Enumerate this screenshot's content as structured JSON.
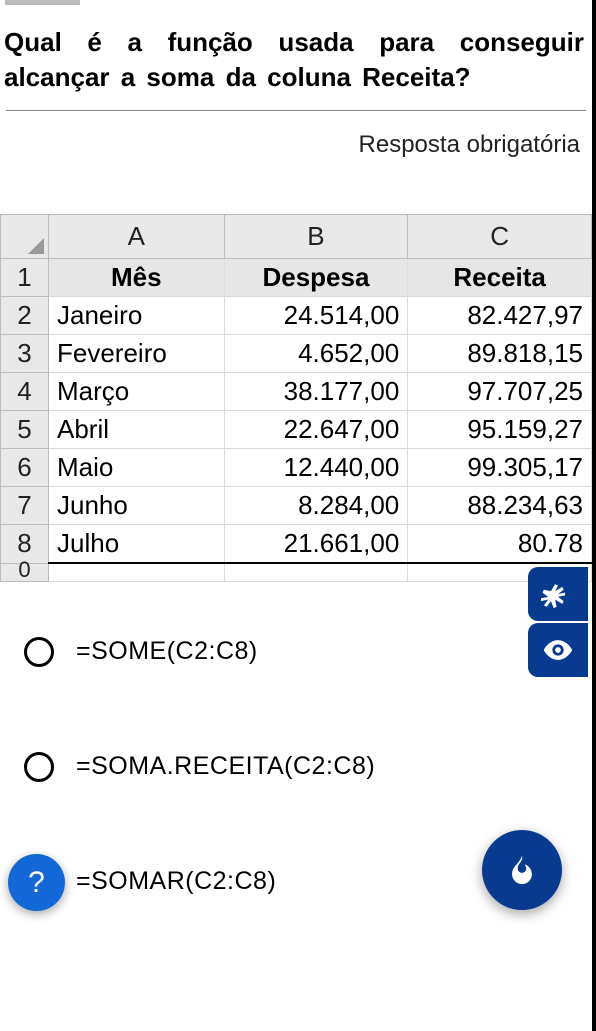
{
  "question": {
    "line1": "Qual é a função usada para conseguir",
    "line2": "alcançar a soma da coluna Receita?"
  },
  "required_label": "Resposta obrigatória",
  "chart_data": {
    "type": "table",
    "columns": [
      "A",
      "B",
      "C"
    ],
    "headers": {
      "A": "Mês",
      "B": "Despesa",
      "C": "Receita"
    },
    "rows": [
      {
        "n": "2",
        "mes": "Janeiro",
        "despesa": "24.514,00",
        "receita": "82.427,97"
      },
      {
        "n": "3",
        "mes": "Fevereiro",
        "despesa": "4.652,00",
        "receita": "89.818,15"
      },
      {
        "n": "4",
        "mes": "Março",
        "despesa": "38.177,00",
        "receita": "97.707,25"
      },
      {
        "n": "5",
        "mes": "Abril",
        "despesa": "22.647,00",
        "receita": "95.159,27"
      },
      {
        "n": "6",
        "mes": "Maio",
        "despesa": "12.440,00",
        "receita": "99.305,17"
      },
      {
        "n": "7",
        "mes": "Junho",
        "despesa": "8.284,00",
        "receita": "88.234,63"
      },
      {
        "n": "8",
        "mes": "Julho",
        "despesa": "21.661,00",
        "receita": "80.78"
      }
    ],
    "row9_label": "0"
  },
  "options": [
    {
      "label": "=SOME(C2:C8)"
    },
    {
      "label": "=SOMA.RECEITA(C2:C8)"
    },
    {
      "label": "=SOMAR(C2:C8)"
    }
  ],
  "help_label": "?"
}
